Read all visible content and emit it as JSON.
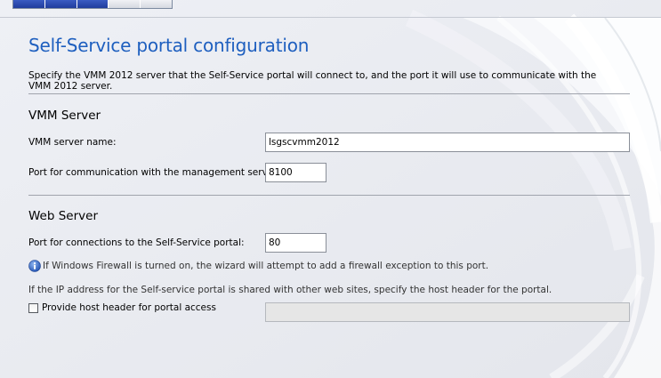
{
  "wizard": {
    "progress_steps_total": 5,
    "progress_steps_done": 3
  },
  "page": {
    "title": "Self-Service portal configuration",
    "description": "Specify the VMM 2012 server that the Self-Service portal will connect to, and the port it will use to communicate with the VMM 2012 server."
  },
  "vmm_server": {
    "heading": "VMM Server",
    "server_name_label": "VMM server name:",
    "server_name_value": "lsgscvmm2012",
    "port_label": "Port for communication with the management server:",
    "port_value": "8100"
  },
  "web_server": {
    "heading": "Web Server",
    "port_label": "Port for connections to the Self-Service portal:",
    "port_value": "80",
    "firewall_info": "If Windows Firewall is turned on, the wizard will attempt to add a firewall exception to this port.",
    "firewall_info_icon": "info-icon",
    "host_header_hint": "If the IP address for the Self-service portal is shared with other web sites, specify the host header for the portal.",
    "host_header_checkbox_label": "Provide host header for portal access",
    "host_header_checked": false,
    "host_header_value": ""
  },
  "colors": {
    "title": "#1e5fbf",
    "progress_fill": "#2b4bb5",
    "background": "#eeeff3"
  }
}
